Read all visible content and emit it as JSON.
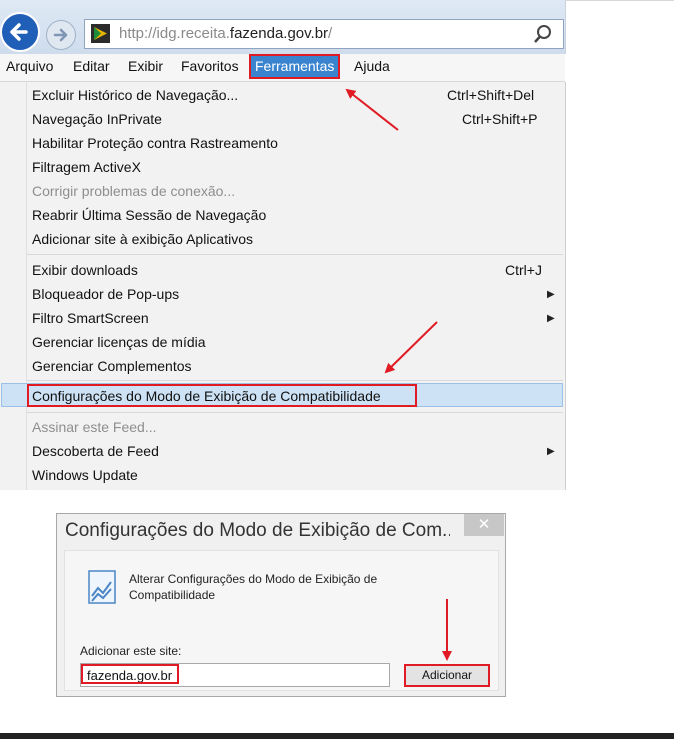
{
  "address_bar": {
    "url_prefix": "http://idg.receita.",
    "url_domain": "fazenda.gov.br",
    "url_suffix": "/"
  },
  "menubar": {
    "items": [
      {
        "label": "Arquivo"
      },
      {
        "label": "Editar"
      },
      {
        "label": "Exibir"
      },
      {
        "label": "Favoritos"
      },
      {
        "label": "Ferramentas"
      },
      {
        "label": "Ajuda"
      }
    ]
  },
  "tools_menu": {
    "items": [
      {
        "label": "Excluir Histórico de Navegação...",
        "shortcut": "Ctrl+Shift+Del"
      },
      {
        "label": "Navegação InPrivate",
        "shortcut": "Ctrl+Shift+P"
      },
      {
        "label": "Habilitar Proteção contra Rastreamento"
      },
      {
        "label": "Filtragem ActiveX"
      },
      {
        "label": "Corrigir problemas de conexão...",
        "disabled": true
      },
      {
        "label": "Reabrir Última Sessão de Navegação"
      },
      {
        "label": "Adicionar site à exibição Aplicativos"
      },
      {
        "label": "Exibir downloads",
        "shortcut": "Ctrl+J"
      },
      {
        "label": "Bloqueador de Pop-ups",
        "submenu": true
      },
      {
        "label": "Filtro SmartScreen",
        "submenu": true
      },
      {
        "label": "Gerenciar licenças de mídia"
      },
      {
        "label": "Gerenciar Complementos"
      },
      {
        "label": "Configurações do Modo de Exibição de Compatibilidade",
        "highlighted": true
      },
      {
        "label": "Assinar este Feed...",
        "disabled": true
      },
      {
        "label": "Descoberta de Feed",
        "submenu": true
      },
      {
        "label": "Windows Update"
      }
    ]
  },
  "dialog": {
    "title": "Configurações do Modo de Exibição de Com...",
    "close_glyph": "✕",
    "description": "Alterar Configurações do Modo de Exibição de Compatibilidade",
    "add_label": "Adicionar este site:",
    "site_value": "fazenda.gov.br",
    "add_button": "Adicionar"
  },
  "colors": {
    "highlight_red": "#e01b24",
    "menu_active": "#3a84cf",
    "back_button": "#1f5fb8"
  },
  "icons": {
    "back": "back-arrow-icon",
    "forward": "forward-arrow-icon",
    "search": "search-icon",
    "submenu": "chevron-right-icon"
  }
}
